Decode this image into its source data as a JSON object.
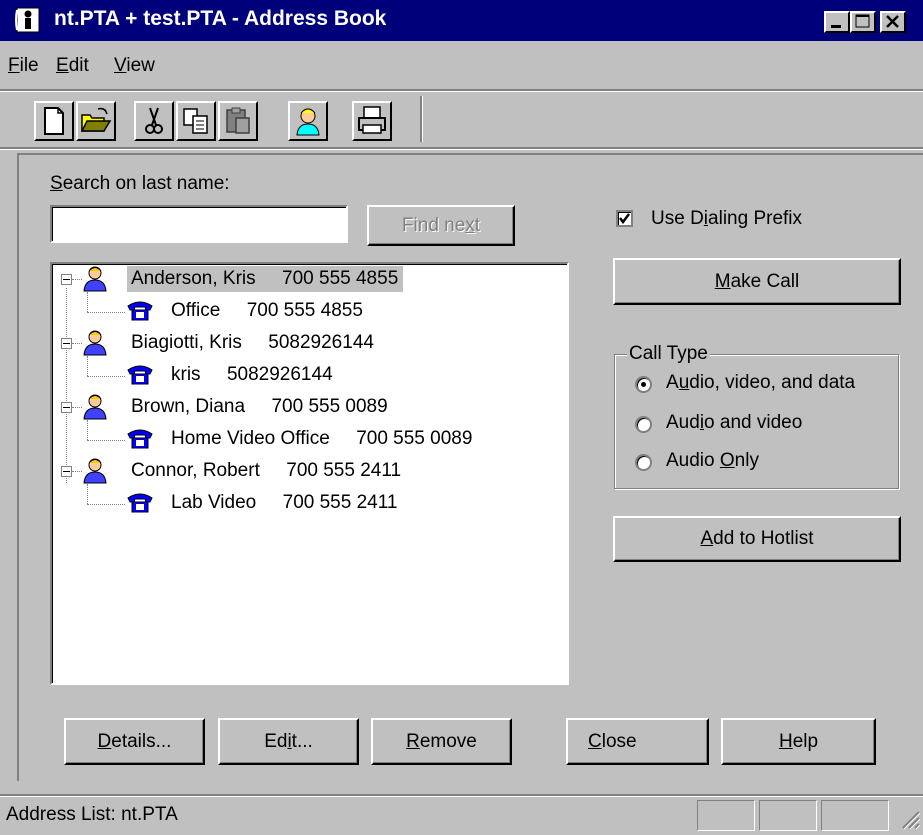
{
  "window": {
    "title": "nt.PTA + test.PTA - Address Book",
    "title_color": "#00007b",
    "face_color": "#c0c0c0"
  },
  "menu": [
    {
      "label": "File",
      "accel": "F"
    },
    {
      "label": "Edit",
      "accel": "E"
    },
    {
      "label": "View",
      "accel": "V"
    }
  ],
  "toolbar": {
    "buttons": [
      "new-icon",
      "open-folder-icon",
      "cut-icon",
      "copy-icon",
      "paste-icon",
      "person-icon",
      "print-icon"
    ]
  },
  "search": {
    "label_pre": "",
    "label_accel": "S",
    "label_post": "earch on last name:",
    "value": "",
    "find_next_label_pre": "Find ne",
    "find_next_accel": "x",
    "find_next_label_post": "t"
  },
  "tree": {
    "contacts": [
      {
        "name": "Anderson, Kris",
        "number": "700 555 4855",
        "selected": true,
        "entry": {
          "label": "Office",
          "number": "700 555 4855"
        }
      },
      {
        "name": "Biagiotti, Kris",
        "number": "5082926144",
        "entry": {
          "label": "kris",
          "number": "5082926144"
        }
      },
      {
        "name": "Brown, Diana",
        "number": "700 555 0089",
        "entry": {
          "label": "Home Video Office",
          "number": "700 555 0089"
        }
      },
      {
        "name": "Connor, Robert",
        "number": "700 555 2411",
        "entry": {
          "label": "Lab Video",
          "number": "700 555 2411"
        }
      }
    ]
  },
  "dialing_prefix": {
    "checked": true,
    "pre": "Use D",
    "accel": "i",
    "post": "aling Prefix"
  },
  "make_call": {
    "pre": "",
    "accel": "M",
    "post": "ake Call"
  },
  "call_type": {
    "legend": "Call Type",
    "options": [
      {
        "pre": "A",
        "accel": "u",
        "post": "dio, video, and data",
        "checked": true
      },
      {
        "pre": "Aud",
        "accel": "i",
        "post": "o and video",
        "checked": false
      },
      {
        "pre": "Audio ",
        "accel": "O",
        "post": "nly",
        "checked": false
      }
    ]
  },
  "add_hotlist": {
    "pre": "",
    "accel": "A",
    "post": "dd to Hotlist"
  },
  "bottom_buttons": {
    "details": {
      "pre": "",
      "accel": "D",
      "post": "etails..."
    },
    "edit": {
      "pre": "Ed",
      "accel": "i",
      "post": "t..."
    },
    "remove": {
      "pre": "",
      "accel": "R",
      "post": "emove"
    },
    "close": {
      "pre": "",
      "accel": "C",
      "post": "lose"
    },
    "help": {
      "pre": "",
      "accel": "H",
      "post": "elp"
    }
  },
  "status": {
    "text": "Address List: nt.PTA"
  }
}
